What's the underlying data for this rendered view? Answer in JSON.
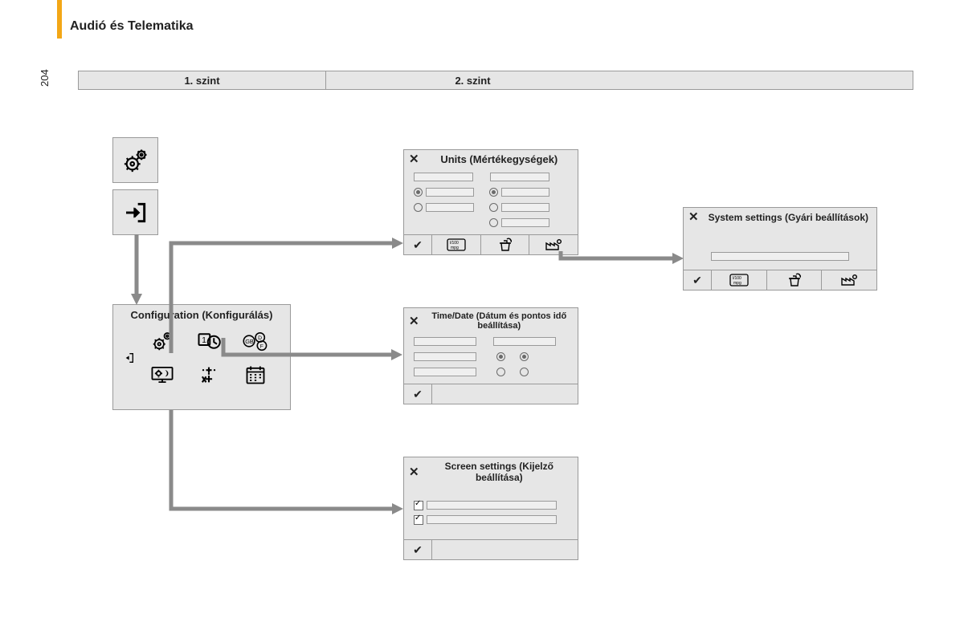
{
  "page": {
    "section_title": "Audió és Telematika",
    "number": "204"
  },
  "levels": {
    "l1": "1. szint",
    "l2": "2. szint",
    "l3": ""
  },
  "icons": {
    "settings": "gears-icon",
    "enter": "enter-icon"
  },
  "config": {
    "title": "Configuration (Konfigurálás)",
    "items": [
      "settings",
      "time-date",
      "language",
      "display",
      "units",
      "calendar"
    ]
  },
  "dialogs": {
    "units": {
      "title": "Units (Mértékegységek)",
      "footer_cells": 4
    },
    "time": {
      "title": "Time/Date (Dátum és pontos idő beállítása)",
      "footer_cells": 2
    },
    "screen": {
      "title": "Screen settings (Kijelző beállítása)",
      "footer_cells": 2
    },
    "system": {
      "title": "System settings (Gyári beállítások)",
      "footer_cells": 4
    }
  }
}
